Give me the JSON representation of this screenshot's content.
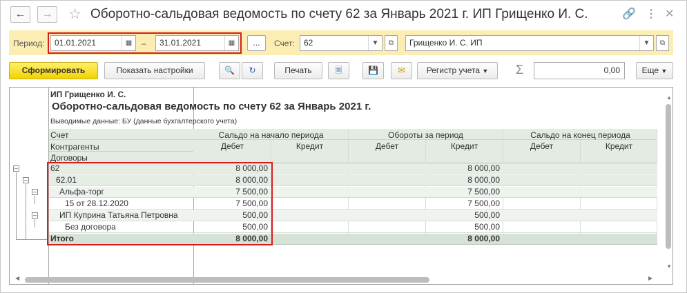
{
  "window": {
    "title": "Оборотно-сальдовая ведомость по счету 62 за Январь 2021 г. ИП Грищенко И. С."
  },
  "params": {
    "period_label": "Период:",
    "date_from": "01.01.2021",
    "dash": "–",
    "date_to": "31.01.2021",
    "more_label": "...",
    "account_label": "Счет:",
    "account_value": "62",
    "org_value": "Грищенко И. С. ИП"
  },
  "toolbar": {
    "generate": "Сформировать",
    "settings": "Показать настройки",
    "print": "Печать",
    "registry": "Регистр учета",
    "sum_value": "0,00",
    "more": "Еще"
  },
  "report": {
    "org": "ИП Грищенко И. С.",
    "title": "Оборотно-сальдовая ведомость по счету 62 за Январь 2021 г.",
    "data_shown": "Выводимые данные:  БУ (данные бухгалтерского учета)",
    "headers": {
      "account": "Счет",
      "counterparties": "Контрагенты",
      "contracts": "Договоры",
      "opening": "Сальдо на начало периода",
      "turnover": "Обороты за период",
      "closing": "Сальдо на конец периода",
      "debit": "Дебет",
      "credit": "Кредит"
    },
    "rows": [
      {
        "name": "62",
        "open_debit": "8 000,00",
        "turn_credit": "8 000,00"
      },
      {
        "name": "62.01",
        "open_debit": "8 000,00",
        "turn_credit": "8 000,00"
      },
      {
        "name": "Альфа-торг",
        "open_debit": "7 500,00",
        "turn_credit": "7 500,00"
      },
      {
        "name": "15 от 28.12.2020",
        "open_debit": "7 500,00",
        "turn_credit": "7 500,00"
      },
      {
        "name": "ИП Куприна Татьяна Петровна",
        "open_debit": "500,00",
        "turn_credit": "500,00"
      },
      {
        "name": "Без договора",
        "open_debit": "500,00",
        "turn_credit": "500,00"
      },
      {
        "name": "Итого",
        "open_debit": "8 000,00",
        "turn_credit": "8 000,00"
      }
    ]
  },
  "icons": {
    "back": "arrow-left-icon",
    "forward": "arrow-right-icon",
    "star": "star-icon",
    "link": "link-icon",
    "menu": "more-vert-icon",
    "close": "close-icon",
    "calendar": "calendar-icon",
    "dropdown": "chevron-down-icon",
    "open": "open-window-icon",
    "search": "search-icon",
    "search_next": "search-next-icon",
    "preview": "preview-icon",
    "save": "save-icon",
    "mail": "mail-icon",
    "sigma": "sigma-icon"
  },
  "colors": {
    "accent": "#f1d300",
    "param_bar": "#fcedb2",
    "highlight": "#d71c1c",
    "row_bg": "#eef3ee"
  }
}
